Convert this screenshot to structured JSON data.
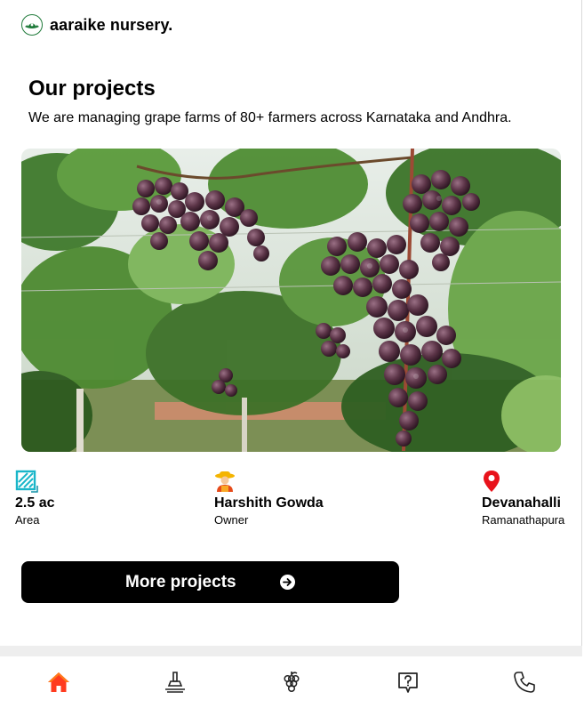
{
  "header": {
    "brand": "aaraike nursery.",
    "logo_icon": "nursery-logo-icon"
  },
  "section": {
    "title": "Our projects",
    "subtitle": "We are managing grape farms of 80+ farmers across Karnataka and Andhra."
  },
  "image": {
    "subject": "grape-vineyard-photo"
  },
  "stats": [
    {
      "icon": "area-icon",
      "value": "2.5 ac",
      "label": "Area"
    },
    {
      "icon": "farmer-icon",
      "value": "Harshith Gowda",
      "label": "Owner"
    },
    {
      "icon": "location-pin-icon",
      "value": "Devanahalli",
      "label": "Ramanathapura"
    }
  ],
  "button": {
    "label": "More projects",
    "icon": "arrow-right-circle-icon"
  },
  "nav": {
    "items": [
      {
        "icon": "home-icon",
        "active": true
      },
      {
        "icon": "soil-tool-icon",
        "active": false
      },
      {
        "icon": "grapes-icon",
        "active": false
      },
      {
        "icon": "help-icon",
        "active": false
      },
      {
        "icon": "phone-icon",
        "active": false
      }
    ]
  },
  "colors": {
    "active": "#ff3b1f",
    "brand_green": "#1f7a3a",
    "button": "#000000",
    "pin": "#e8131b",
    "area": "#19b6c9"
  }
}
